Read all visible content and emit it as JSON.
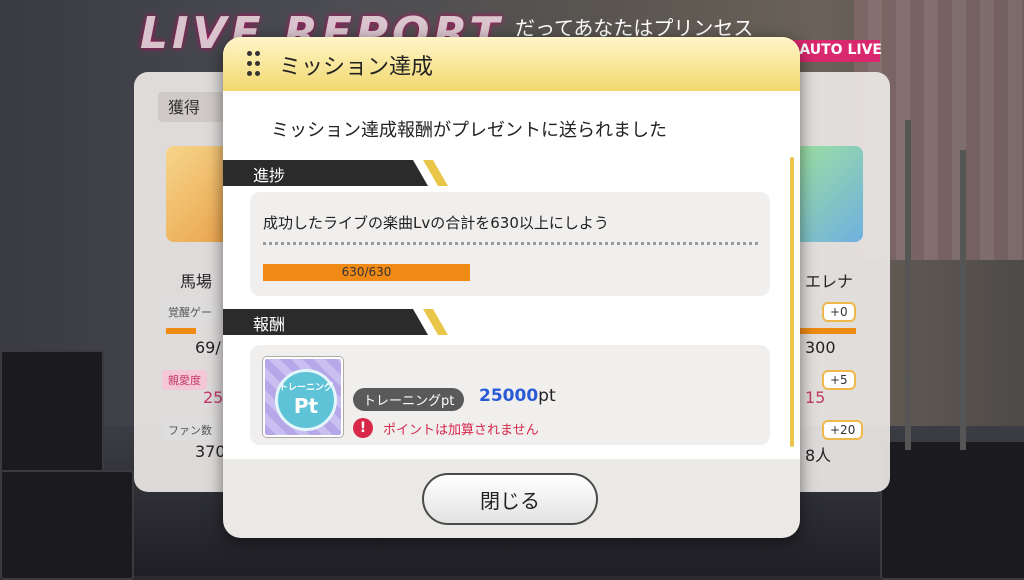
{
  "background": {
    "live_report": "LIVE REPORT",
    "song_title": "だってあなたはプリンセス",
    "auto_live": "AUTO LIVE",
    "acquired_tab": "獲得"
  },
  "result_panel": {
    "left_name": "馬場",
    "left_gauge": "覚醒ゲー",
    "left_gauge_value": "69/",
    "left_affection": "親愛度",
    "left_affection_value": "25",
    "left_fans": "ファン数",
    "left_fans_value": "370",
    "right_name": "エレナ",
    "right_gauge_plus": "+0",
    "right_gauge_value": "300",
    "right_affection_plus": "+5",
    "right_affection_value": "15",
    "right_fans_plus": "+20",
    "right_fans_value": "8人"
  },
  "modal": {
    "title": "ミッション達成",
    "info": "ミッション達成報酬がプレゼントに送られました",
    "progress_section": "進捗",
    "mission_text": "成功したライブの楽曲Lvの合計を630以上にしよう",
    "progress_current": 630,
    "progress_max": 630,
    "progress_text": "630/630",
    "reward_section": "報酬",
    "reward_icon_small": "トレーニング",
    "reward_icon_big": "Pt",
    "reward_name": "トレーニングpt",
    "reward_amount": "25000",
    "reward_unit": "pt",
    "warning": "ポイントは加算されません",
    "close_label": "閉じる"
  },
  "colors": {
    "accent_gold": "#e9c64a",
    "progress_orange": "#f08a14",
    "warning_red": "#d8284a",
    "amount_blue": "#2a5bd7"
  }
}
